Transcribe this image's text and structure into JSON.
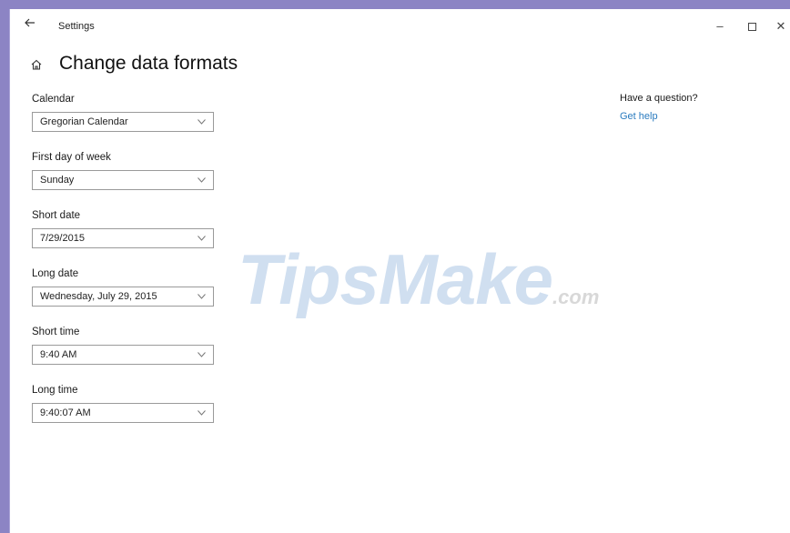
{
  "window": {
    "title": "Settings",
    "back_icon": "arrow-left-icon",
    "controls": {
      "minimize": "–",
      "close": "✕"
    }
  },
  "page": {
    "title": "Change data formats",
    "icon": "home-icon"
  },
  "fields": [
    {
      "label": "Calendar",
      "value": "Gregorian Calendar"
    },
    {
      "label": "First day of week",
      "value": "Sunday"
    },
    {
      "label": "Short date",
      "value": "7/29/2015"
    },
    {
      "label": "Long date",
      "value": "Wednesday, July 29, 2015"
    },
    {
      "label": "Short time",
      "value": "9:40 AM"
    },
    {
      "label": "Long time",
      "value": "9:40:07 AM"
    }
  ],
  "aside": {
    "heading": "Have a question?",
    "link": "Get help"
  },
  "watermark": {
    "main": "TipsMake",
    "suffix": ".com"
  },
  "colors": {
    "link": "#2a7bbf",
    "frame": "#8c84c4"
  }
}
